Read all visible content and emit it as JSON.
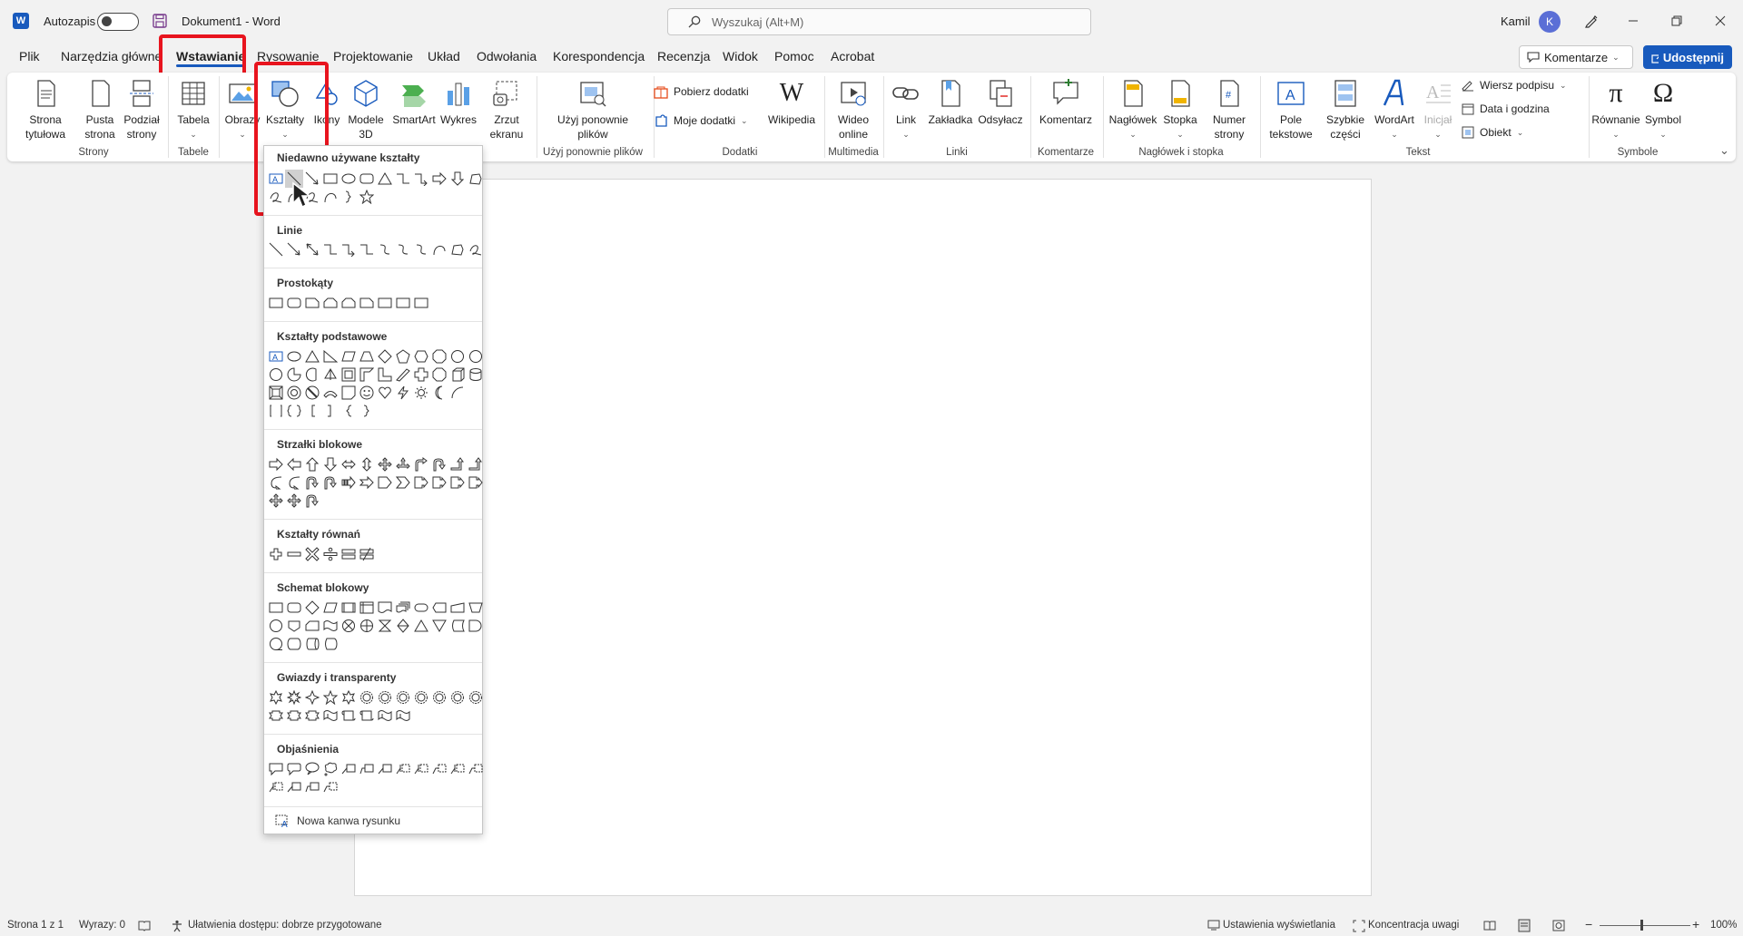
{
  "titlebar": {
    "autosave_label": "Autozapis",
    "doc_title": "Dokument1 - Word",
    "search_placeholder": "Wyszukaj (Alt+M)",
    "user_name": "Kamil",
    "user_initial": "K"
  },
  "tabs": [
    "Plik",
    "Narzędzia główne",
    "Wstawianie",
    "Rysowanie",
    "Projektowanie",
    "Układ",
    "Odwołania",
    "Korespondencja",
    "Recenzja",
    "Widok",
    "Pomoc",
    "Acrobat"
  ],
  "active_tab": "Wstawianie",
  "top_buttons": {
    "comments": "Komentarze",
    "share": "Udostępnij"
  },
  "ribbon": {
    "strony": {
      "group": "Strony",
      "items": [
        "Strona\ntytułowa",
        "Pusta\nstrona",
        "Podział\nstrony"
      ]
    },
    "tabele": {
      "group": "Tabele",
      "items": [
        "Tabela"
      ]
    },
    "ilustracje": {
      "items": [
        "Obrazy",
        "Kształty",
        "Ikony",
        "Modele\n3D",
        "SmartArt",
        "Wykres",
        "Zrzut\nekranu"
      ]
    },
    "ponowne": {
      "group": "Użyj ponownie plików",
      "items": [
        "Użyj ponownie\nplików"
      ]
    },
    "dodatki": {
      "group": "Dodatki",
      "items": [
        "Pobierz dodatki",
        "Moje dodatki",
        "Wikipedia"
      ]
    },
    "multimedia": {
      "group": "Multimedia",
      "items": [
        "Wideo\nonline"
      ]
    },
    "linki": {
      "group": "Linki",
      "items": [
        "Link",
        "Zakładka",
        "Odsyłacz"
      ]
    },
    "komentarze": {
      "group": "Komentarze",
      "items": [
        "Komentarz"
      ]
    },
    "naglowek": {
      "group": "Nagłówek i stopka",
      "items": [
        "Nagłówek",
        "Stopka",
        "Numer\nstrony"
      ]
    },
    "tekst": {
      "group": "Tekst",
      "items": [
        "Pole\ntekstowe",
        "Szybkie\nczęści",
        "WordArt",
        "Inicjał",
        "Wiersz podpisu",
        "Data i godzina",
        "Obiekt"
      ]
    },
    "symbole": {
      "group": "Symbole",
      "items": [
        "Równanie",
        "Symbol"
      ]
    }
  },
  "dropdown": {
    "sections": [
      "Niedawno używane kształty",
      "Linie",
      "Prostokąty",
      "Kształty podstawowe",
      "Strzałki blokowe",
      "Kształty równań",
      "Schemat blokowy",
      "Gwiazdy i transparenty",
      "Objaśnienia"
    ],
    "footer": "Nowa kanwa rysunku"
  },
  "status": {
    "page": "Strona 1 z 1",
    "words": "Wyrazy: 0",
    "accessibility": "Ułatwienia dostępu: dobrze przygotowane",
    "display_settings": "Ustawienia wyświetlania",
    "focus": "Koncentracja uwagi",
    "zoom": "100%"
  },
  "colors": {
    "accent": "#185abd",
    "highlight": "#e8141e",
    "purple": "#a4373a"
  }
}
